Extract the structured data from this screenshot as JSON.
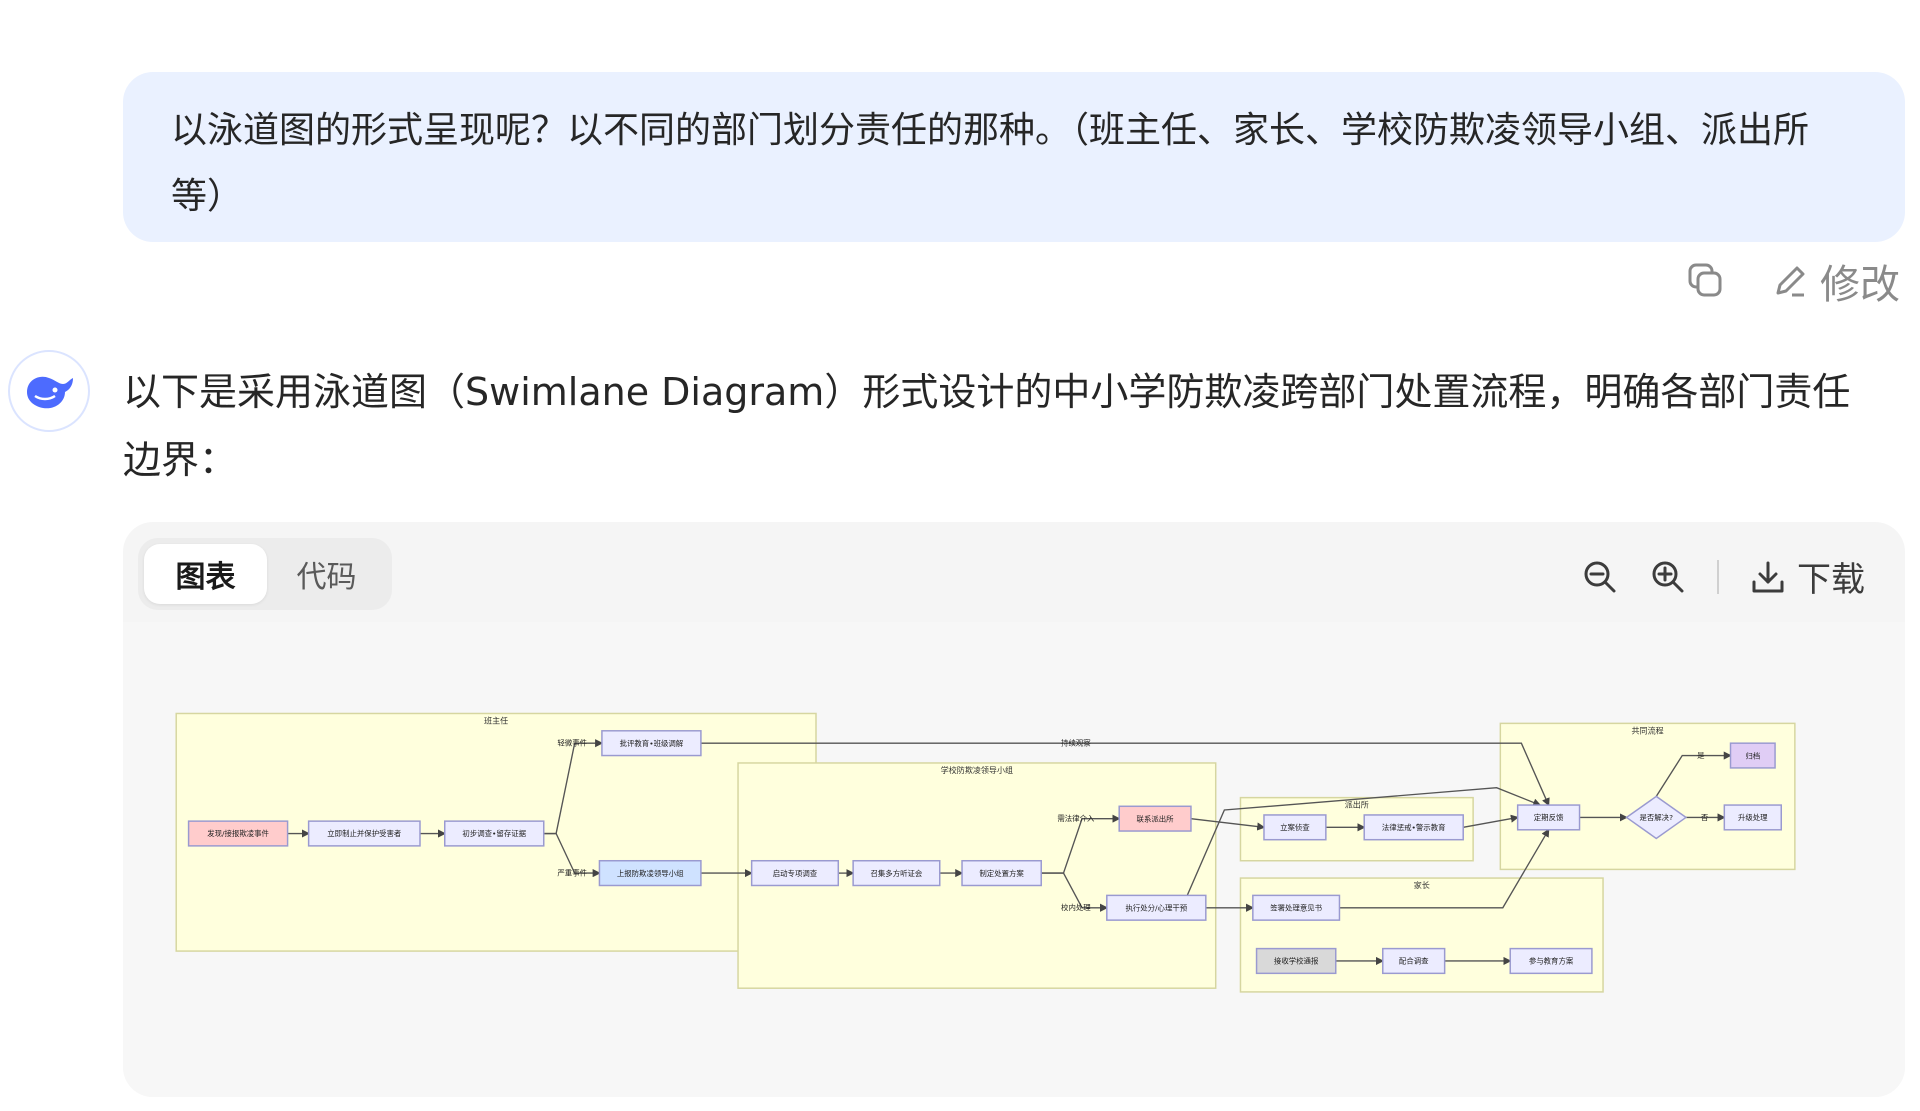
{
  "user_message": {
    "text": "以泳道图的形式呈现呢？以不同的部门划分责任的那种。（班主任、家长、学校防欺凌领导小组、派出所等）"
  },
  "message_actions": {
    "copy_icon": "copy-icon",
    "edit_icon": "pencil-icon",
    "edit_label": "修改"
  },
  "assistant": {
    "avatar_icon": "whale-logo",
    "text": "以下是采用泳道图（Swimlane Diagram）形式设计的中小学防欺凌跨部门处置流程，明确各部门责任边界："
  },
  "chart_card": {
    "tab_chart": "图表",
    "tab_code": "代码",
    "zoom_out_icon": "zoom-out-icon",
    "zoom_in_icon": "zoom-in-icon",
    "download_icon": "download-icon",
    "download_label": "下载"
  },
  "diagram": {
    "lanes": [
      {
        "id": "teacher",
        "title": "班主任"
      },
      {
        "id": "group",
        "title": "学校防欺凌领导小组"
      },
      {
        "id": "police",
        "title": "派出所"
      },
      {
        "id": "parent",
        "title": "家长"
      },
      {
        "id": "common",
        "title": "共同流程"
      }
    ],
    "nodes": [
      {
        "id": "n1",
        "label": "发现/接报欺凌事件",
        "style": "red"
      },
      {
        "id": "n2",
        "label": "立即制止并保护受害者",
        "style": "normal"
      },
      {
        "id": "n3",
        "label": "初步调查•留存证据",
        "style": "normal"
      },
      {
        "id": "n4",
        "label": "批评教育•班级调解",
        "style": "normal"
      },
      {
        "id": "n5",
        "label": "上报防欺凌领导小组",
        "style": "blue"
      },
      {
        "id": "n6",
        "label": "启动专项调查",
        "style": "normal"
      },
      {
        "id": "n7",
        "label": "召集多方听证会",
        "style": "normal"
      },
      {
        "id": "n8",
        "label": "制定处置方案",
        "style": "normal"
      },
      {
        "id": "n9",
        "label": "联系派出所",
        "style": "red"
      },
      {
        "id": "n10",
        "label": "执行处分/心理干预",
        "style": "normal"
      },
      {
        "id": "n11",
        "label": "立案侦查",
        "style": "normal"
      },
      {
        "id": "n12",
        "label": "法律惩戒•警示教育",
        "style": "normal"
      },
      {
        "id": "n13",
        "label": "签署处理意见书",
        "style": "normal"
      },
      {
        "id": "n14",
        "label": "接收学校通报",
        "style": "gray"
      },
      {
        "id": "n15",
        "label": "配合调查",
        "style": "normal"
      },
      {
        "id": "n16",
        "label": "参与教育方案",
        "style": "normal"
      },
      {
        "id": "n17",
        "label": "定期反馈",
        "style": "normal"
      },
      {
        "id": "n18",
        "label": "是否解决?",
        "style": "diamond"
      },
      {
        "id": "n19",
        "label": "归档",
        "style": "purple"
      },
      {
        "id": "n20",
        "label": "升级处理",
        "style": "normal"
      }
    ],
    "edge_labels": {
      "minor": "轻微事件",
      "serious": "严重事件",
      "observe": "持续观察",
      "legal": "需法律介入",
      "inschool": "校内处理",
      "yes": "是",
      "no": "否"
    }
  }
}
